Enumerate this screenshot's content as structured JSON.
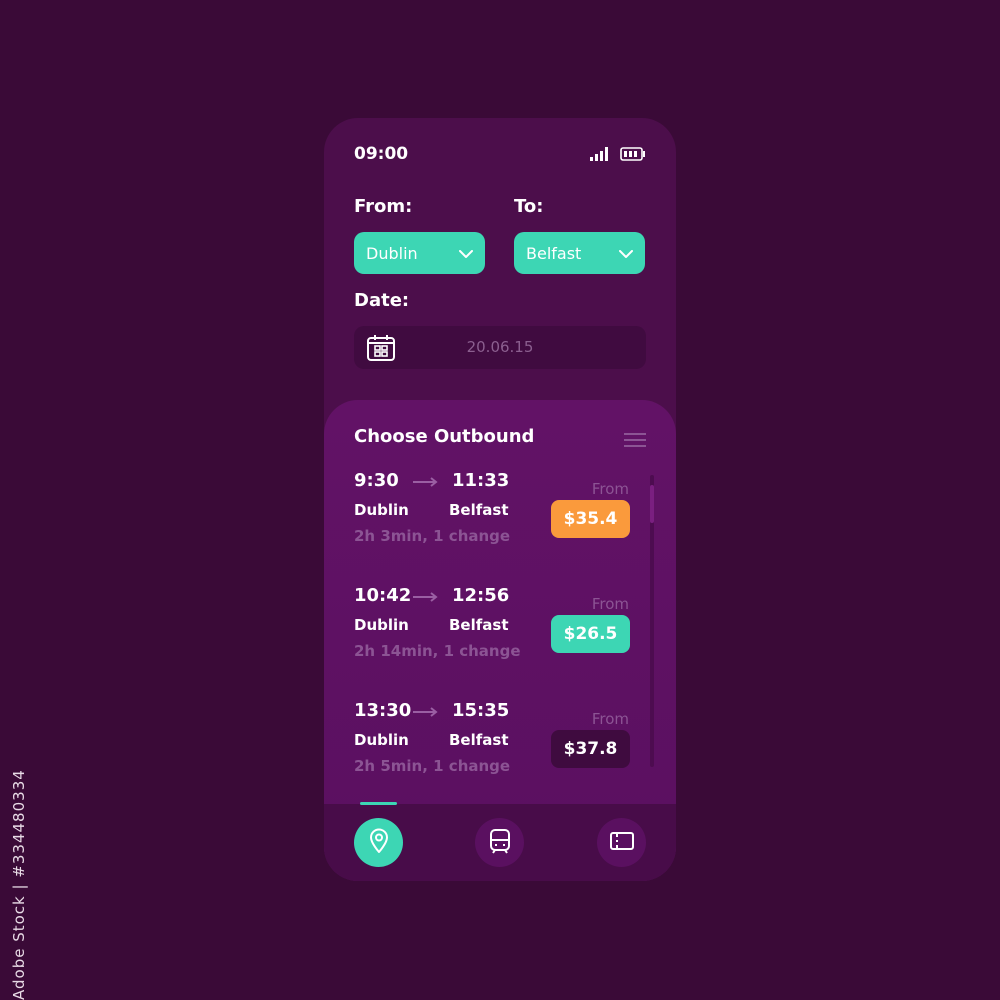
{
  "watermark": {
    "side_id": "Adobe Stock | #334480334"
  },
  "status_bar": {
    "time": "09:00"
  },
  "search": {
    "from_label": "From:",
    "from_value": "Dublin",
    "to_label": "To:",
    "to_value": "Belfast",
    "date_label": "Date:",
    "date_value": "20.06.15"
  },
  "results": {
    "title": "Choose Outbound",
    "trips": [
      {
        "depart": "9:30",
        "arrive": "11:33",
        "from_city": "Dublin",
        "to_city": "Belfast",
        "duration": "2h 3min, 1 change",
        "price_prefix": "From",
        "price": "$35.4",
        "price_color": "#fa9a3c"
      },
      {
        "depart": "10:42",
        "arrive": "12:56",
        "from_city": "Dublin",
        "to_city": "Belfast",
        "duration": "2h 14min, 1 change",
        "price_prefix": "From",
        "price": "$26.5",
        "price_color": "#3dd6b4"
      },
      {
        "depart": "13:30",
        "arrive": "15:35",
        "from_city": "Dublin",
        "to_city": "Belfast",
        "duration": "2h 5min, 1 change",
        "price_prefix": "From",
        "price": "$37.8",
        "price_color": "#3f0b3f"
      }
    ]
  },
  "nav": {
    "items": [
      {
        "icon": "location-pin-icon",
        "active": true
      },
      {
        "icon": "train-icon",
        "active": false
      },
      {
        "icon": "ticket-icon",
        "active": false
      }
    ]
  },
  "colors": {
    "accent": "#3dd6b4",
    "highlight": "#fa9a3c",
    "background": "#3a0a37",
    "phone": "#4c0e4b"
  }
}
